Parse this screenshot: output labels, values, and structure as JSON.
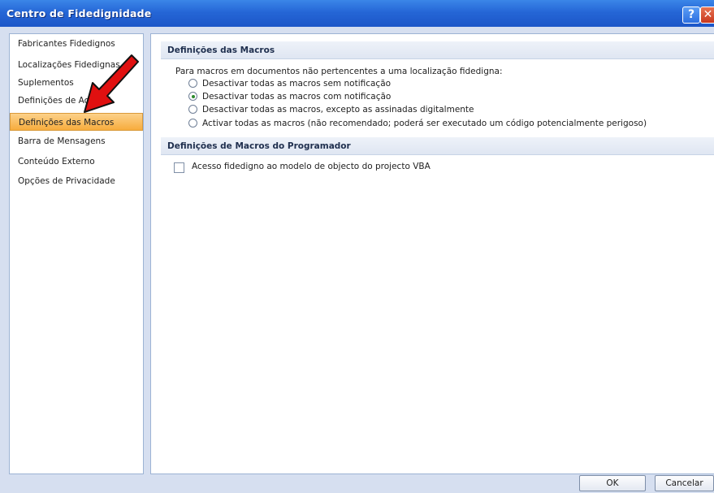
{
  "window": {
    "title": "Centro de Fidedignidade",
    "help_glyph": "?",
    "close_glyph": "✕"
  },
  "sidebar": {
    "items": [
      {
        "label": "Fabricantes Fidedignos"
      },
      {
        "label": "Localizações Fidedignas"
      },
      {
        "label": "Suplementos"
      },
      {
        "label": "Definições de ActiveX"
      },
      {
        "label": "Definições das Macros",
        "selected": true
      },
      {
        "label": "Barra de Mensagens"
      },
      {
        "label": "Conteúdo Externo"
      },
      {
        "label": "Opções de Privacidade"
      }
    ]
  },
  "macros": {
    "header": "Definições das Macros",
    "intro": "Para macros em documentos não pertencentes a uma localização fidedigna:",
    "options": [
      {
        "label": "Desactivar todas as macros sem notificação",
        "selected": false
      },
      {
        "label": "Desactivar todas as macros com notificação",
        "selected": true
      },
      {
        "label": "Desactivar todas as macros, excepto as assinadas digitalmente",
        "selected": false
      },
      {
        "label": "Activar todas as macros (não recomendado; poderá ser executado um código potencialmente perigoso)",
        "selected": false
      }
    ]
  },
  "developer": {
    "header": "Definições de Macros do Programador",
    "vba_access_label": "Acesso fidedigno ao modelo de objecto do projecto VBA",
    "vba_access_checked": false
  },
  "buttons": {
    "ok": "OK",
    "cancel": "Cancelar"
  },
  "colors": {
    "titlebar": "#2566d6",
    "selected_nav": "#f7ac3d",
    "annotation_arrow": "#e01010"
  }
}
